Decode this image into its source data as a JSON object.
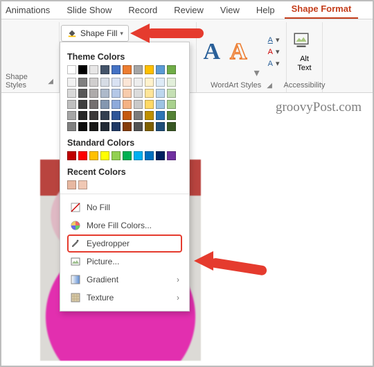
{
  "tabs": {
    "items": [
      {
        "label": "Animations",
        "active": false,
        "partial": true,
        "name": "tab-animations"
      },
      {
        "label": "Slide Show",
        "active": false,
        "name": "tab-slideshow"
      },
      {
        "label": "Record",
        "active": false,
        "name": "tab-record"
      },
      {
        "label": "Review",
        "active": false,
        "name": "tab-review"
      },
      {
        "label": "View",
        "active": false,
        "name": "tab-view"
      },
      {
        "label": "Help",
        "active": false,
        "name": "tab-help"
      },
      {
        "label": "Shape Format",
        "active": true,
        "name": "tab-shape-format"
      }
    ]
  },
  "ribbon": {
    "shapeFill": {
      "label": "Shape Fill"
    },
    "groups": {
      "shapeStyles": {
        "label": "Shape Styles"
      },
      "wordartStyles": {
        "label": "WordArt Styles"
      },
      "altText": {
        "label": "Alt Text"
      },
      "accessibility": {
        "label": "Accessibility"
      }
    },
    "wordartSamples": [
      "A",
      "A"
    ],
    "wordartColors": [
      "#2a6099",
      "#ed7d31"
    ]
  },
  "shapeFillDropdown": {
    "themeColorsLabel": "Theme Colors",
    "themeTopRow": [
      "#ffffff",
      "#000000",
      "#e7e6e6",
      "#44546a",
      "#4472c4",
      "#ed7d31",
      "#a5a5a5",
      "#ffc000",
      "#5b9bd5",
      "#70ad47"
    ],
    "themeShades": [
      [
        "#f2f2f2",
        "#d9d9d9",
        "#bfbfbf",
        "#a6a6a6",
        "#808080"
      ],
      [
        "#808080",
        "#595959",
        "#404040",
        "#262626",
        "#0d0d0d"
      ],
      [
        "#d0cece",
        "#aeabab",
        "#757070",
        "#3b3838",
        "#171716"
      ],
      [
        "#d6dce5",
        "#adb9ca",
        "#8497b0",
        "#333f50",
        "#222a35"
      ],
      [
        "#d9e2f3",
        "#b4c7e7",
        "#8eaadb",
        "#2f5597",
        "#1f3864"
      ],
      [
        "#fbe5d6",
        "#f7cbac",
        "#f4b183",
        "#c55a11",
        "#843c0b"
      ],
      [
        "#ededed",
        "#dbdbdb",
        "#c9c9c9",
        "#7b7b7b",
        "#525252"
      ],
      [
        "#fff2cc",
        "#fee599",
        "#ffd966",
        "#bf9000",
        "#7f6000"
      ],
      [
        "#deebf7",
        "#bdd7ee",
        "#9dc3e3",
        "#2e75b6",
        "#1f4e79"
      ],
      [
        "#e2efda",
        "#c5e0b4",
        "#a9d18e",
        "#548235",
        "#385723"
      ]
    ],
    "standardColorsLabel": "Standard Colors",
    "standardColors": [
      "#c00000",
      "#ff0000",
      "#ffc000",
      "#ffff00",
      "#92d050",
      "#00b050",
      "#00b0f0",
      "#0070c0",
      "#002060",
      "#7030a0"
    ],
    "recentColorsLabel": "Recent Colors",
    "recentColors": [
      "#e7b8a1",
      "#f0c8b4"
    ],
    "items": {
      "noFill": "No Fill",
      "moreColors": "More Fill Colors...",
      "eyedropper": "Eyedropper",
      "picture": "Picture...",
      "gradient": "Gradient",
      "texture": "Texture"
    }
  },
  "watermark": "groovyPost.com"
}
